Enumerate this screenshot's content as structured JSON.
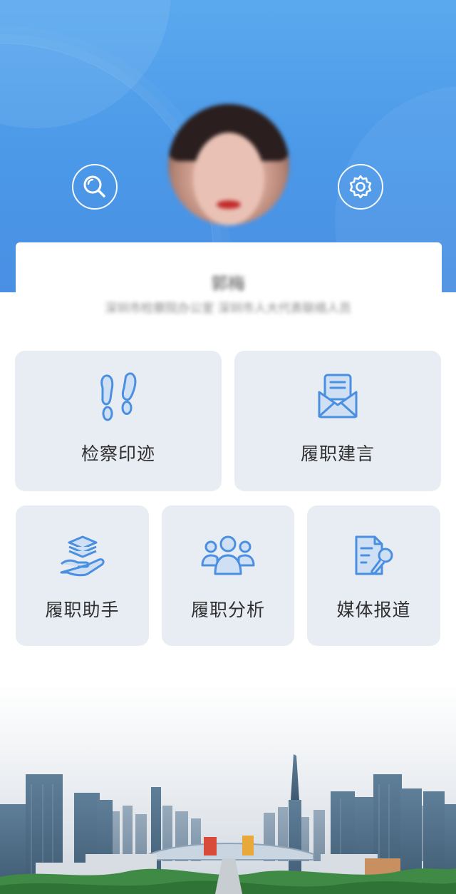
{
  "profile": {
    "name": "郭梅",
    "org": "深圳市检察院办公室 深圳市人大代表联络人员"
  },
  "header": {
    "search_icon": "search-icon",
    "settings_icon": "gear-icon"
  },
  "tiles": [
    {
      "label": "检察印迹",
      "icon": "footprints-icon"
    },
    {
      "label": "履职建言",
      "icon": "mail-letter-icon"
    },
    {
      "label": "履职助手",
      "icon": "hand-stack-icon"
    },
    {
      "label": "履职分析",
      "icon": "people-group-icon"
    },
    {
      "label": "媒体报道",
      "icon": "document-microphone-icon"
    }
  ],
  "colors": {
    "header_blue": "#4b98e8",
    "tile_bg": "#e8edf4",
    "icon_blue": "#4a8fe0"
  }
}
